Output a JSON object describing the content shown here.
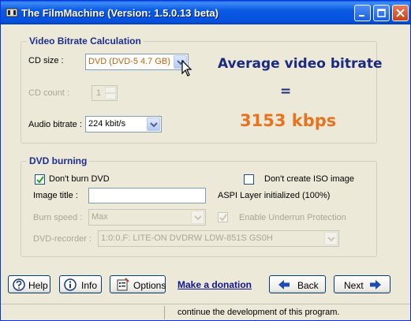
{
  "window": {
    "title": "The FilmMachine   (Version: 1.5.0.13 beta)"
  },
  "bitrate_calc": {
    "group_title": "Video Bitrate Calculation",
    "cd_size": {
      "label": "CD size :",
      "value": "DVD (DVD-5 4.7 GB)"
    },
    "cd_count": {
      "label": "CD count :",
      "value": "1"
    },
    "audio_bitrate": {
      "label": "Audio bitrate :",
      "value": "224 kbit/s"
    },
    "result_label": "Average video bitrate",
    "equals": "=",
    "result_value": "3153 kbps"
  },
  "dvd_burning": {
    "group_title": "DVD burning",
    "dont_burn": {
      "label": "Don't burn DVD",
      "checked": true
    },
    "dont_create_iso": {
      "label": "Don't create ISO image",
      "checked": false
    },
    "image_title": {
      "label": "Image title :",
      "value": ""
    },
    "aspi_status": "ASPI Layer initialized (100%)",
    "burn_speed": {
      "label": "Burn speed :",
      "value": "Max"
    },
    "underrun": {
      "label": "Enable Underrun Protection",
      "checked": true
    },
    "recorder": {
      "label": "DVD-recorder :",
      "value": "1:0:0,F: LITE-ON DVDRW LDW-851S  GS0H"
    }
  },
  "buttons": {
    "help": "Help",
    "info": "Info",
    "options": "Options",
    "donation": "Make a donation",
    "back": "Back",
    "next": "Next"
  },
  "statusbar": {
    "text": "continue the development of this program."
  },
  "icons": [
    "app-icon",
    "minimize-icon",
    "maximize-icon",
    "close-icon",
    "help-icon",
    "info-icon",
    "options-icon",
    "back-arrow-icon",
    "next-arrow-icon",
    "mouse-cursor-icon",
    "checkmark-icon",
    "chevron-down-icon"
  ],
  "colors": {
    "accent": "#1c2a7d",
    "result": "#e8731f",
    "titlebar": "#0551de"
  }
}
